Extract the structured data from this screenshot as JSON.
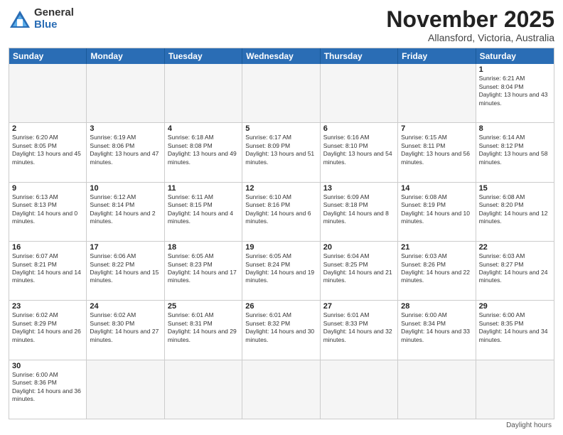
{
  "header": {
    "logo_line1": "General",
    "logo_line2": "Blue",
    "month": "November 2025",
    "location": "Allansford, Victoria, Australia",
    "footer_note": "Daylight hours"
  },
  "days_of_week": [
    "Sunday",
    "Monday",
    "Tuesday",
    "Wednesday",
    "Thursday",
    "Friday",
    "Saturday"
  ],
  "weeks": [
    [
      {
        "day": "",
        "text": ""
      },
      {
        "day": "",
        "text": ""
      },
      {
        "day": "",
        "text": ""
      },
      {
        "day": "",
        "text": ""
      },
      {
        "day": "",
        "text": ""
      },
      {
        "day": "",
        "text": ""
      },
      {
        "day": "1",
        "text": "Sunrise: 6:21 AM\nSunset: 8:04 PM\nDaylight: 13 hours and 43 minutes."
      }
    ],
    [
      {
        "day": "2",
        "text": "Sunrise: 6:20 AM\nSunset: 8:05 PM\nDaylight: 13 hours and 45 minutes."
      },
      {
        "day": "3",
        "text": "Sunrise: 6:19 AM\nSunset: 8:06 PM\nDaylight: 13 hours and 47 minutes."
      },
      {
        "day": "4",
        "text": "Sunrise: 6:18 AM\nSunset: 8:08 PM\nDaylight: 13 hours and 49 minutes."
      },
      {
        "day": "5",
        "text": "Sunrise: 6:17 AM\nSunset: 8:09 PM\nDaylight: 13 hours and 51 minutes."
      },
      {
        "day": "6",
        "text": "Sunrise: 6:16 AM\nSunset: 8:10 PM\nDaylight: 13 hours and 54 minutes."
      },
      {
        "day": "7",
        "text": "Sunrise: 6:15 AM\nSunset: 8:11 PM\nDaylight: 13 hours and 56 minutes."
      },
      {
        "day": "8",
        "text": "Sunrise: 6:14 AM\nSunset: 8:12 PM\nDaylight: 13 hours and 58 minutes."
      }
    ],
    [
      {
        "day": "9",
        "text": "Sunrise: 6:13 AM\nSunset: 8:13 PM\nDaylight: 14 hours and 0 minutes."
      },
      {
        "day": "10",
        "text": "Sunrise: 6:12 AM\nSunset: 8:14 PM\nDaylight: 14 hours and 2 minutes."
      },
      {
        "day": "11",
        "text": "Sunrise: 6:11 AM\nSunset: 8:15 PM\nDaylight: 14 hours and 4 minutes."
      },
      {
        "day": "12",
        "text": "Sunrise: 6:10 AM\nSunset: 8:16 PM\nDaylight: 14 hours and 6 minutes."
      },
      {
        "day": "13",
        "text": "Sunrise: 6:09 AM\nSunset: 8:18 PM\nDaylight: 14 hours and 8 minutes."
      },
      {
        "day": "14",
        "text": "Sunrise: 6:08 AM\nSunset: 8:19 PM\nDaylight: 14 hours and 10 minutes."
      },
      {
        "day": "15",
        "text": "Sunrise: 6:08 AM\nSunset: 8:20 PM\nDaylight: 14 hours and 12 minutes."
      }
    ],
    [
      {
        "day": "16",
        "text": "Sunrise: 6:07 AM\nSunset: 8:21 PM\nDaylight: 14 hours and 14 minutes."
      },
      {
        "day": "17",
        "text": "Sunrise: 6:06 AM\nSunset: 8:22 PM\nDaylight: 14 hours and 15 minutes."
      },
      {
        "day": "18",
        "text": "Sunrise: 6:05 AM\nSunset: 8:23 PM\nDaylight: 14 hours and 17 minutes."
      },
      {
        "day": "19",
        "text": "Sunrise: 6:05 AM\nSunset: 8:24 PM\nDaylight: 14 hours and 19 minutes."
      },
      {
        "day": "20",
        "text": "Sunrise: 6:04 AM\nSunset: 8:25 PM\nDaylight: 14 hours and 21 minutes."
      },
      {
        "day": "21",
        "text": "Sunrise: 6:03 AM\nSunset: 8:26 PM\nDaylight: 14 hours and 22 minutes."
      },
      {
        "day": "22",
        "text": "Sunrise: 6:03 AM\nSunset: 8:27 PM\nDaylight: 14 hours and 24 minutes."
      }
    ],
    [
      {
        "day": "23",
        "text": "Sunrise: 6:02 AM\nSunset: 8:29 PM\nDaylight: 14 hours and 26 minutes."
      },
      {
        "day": "24",
        "text": "Sunrise: 6:02 AM\nSunset: 8:30 PM\nDaylight: 14 hours and 27 minutes."
      },
      {
        "day": "25",
        "text": "Sunrise: 6:01 AM\nSunset: 8:31 PM\nDaylight: 14 hours and 29 minutes."
      },
      {
        "day": "26",
        "text": "Sunrise: 6:01 AM\nSunset: 8:32 PM\nDaylight: 14 hours and 30 minutes."
      },
      {
        "day": "27",
        "text": "Sunrise: 6:01 AM\nSunset: 8:33 PM\nDaylight: 14 hours and 32 minutes."
      },
      {
        "day": "28",
        "text": "Sunrise: 6:00 AM\nSunset: 8:34 PM\nDaylight: 14 hours and 33 minutes."
      },
      {
        "day": "29",
        "text": "Sunrise: 6:00 AM\nSunset: 8:35 PM\nDaylight: 14 hours and 34 minutes."
      }
    ],
    [
      {
        "day": "30",
        "text": "Sunrise: 6:00 AM\nSunset: 8:36 PM\nDaylight: 14 hours and 36 minutes."
      },
      {
        "day": "",
        "text": ""
      },
      {
        "day": "",
        "text": ""
      },
      {
        "day": "",
        "text": ""
      },
      {
        "day": "",
        "text": ""
      },
      {
        "day": "",
        "text": ""
      },
      {
        "day": "",
        "text": ""
      }
    ]
  ]
}
